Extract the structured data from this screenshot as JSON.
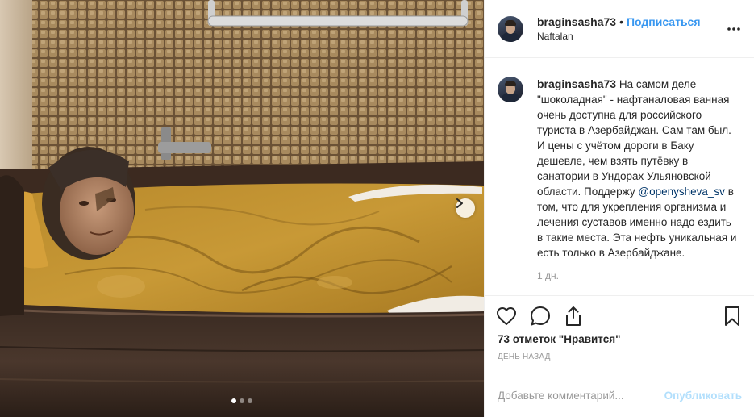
{
  "post": {
    "username": "braginsasha73",
    "separator": "•",
    "follow_label": "Подписаться",
    "location": "Naftalan",
    "more_icon": "more-horizontal-icon"
  },
  "caption": {
    "username": "braginsasha73",
    "text_before": "На самом деле \"шоколадная\" - нафтаналовая ванная очень доступна для российского туриста в Азербайджан. Сам там был. И цены с учётом дороги в Баку дешевле, чем взять путёвку в санатории в Ундорах Ульяновской области. Поддержу",
    "mention": "@openysheva_sv",
    "text_after": "в том, что для укрепления организма и лечения суставов именно надо ездить в такие места. Эта нефть уникальная и есть только в Азербайджане.",
    "time": "1 дн."
  },
  "actions": {
    "like_icon": "heart-icon",
    "comment_icon": "comment-icon",
    "share_icon": "share-icon",
    "save_icon": "bookmark-icon"
  },
  "likes": "73 отметок \"Нравится\"",
  "time_ago": "день назад",
  "comment": {
    "placeholder": "Добавьте комментарий...",
    "publish_label": "Опубликовать"
  },
  "carousel": {
    "count": 3,
    "active_index": 0
  },
  "colors": {
    "accent": "#3897f0",
    "publish_disabled": "#b2dffc",
    "muted": "#999999",
    "mention": "#003569"
  }
}
